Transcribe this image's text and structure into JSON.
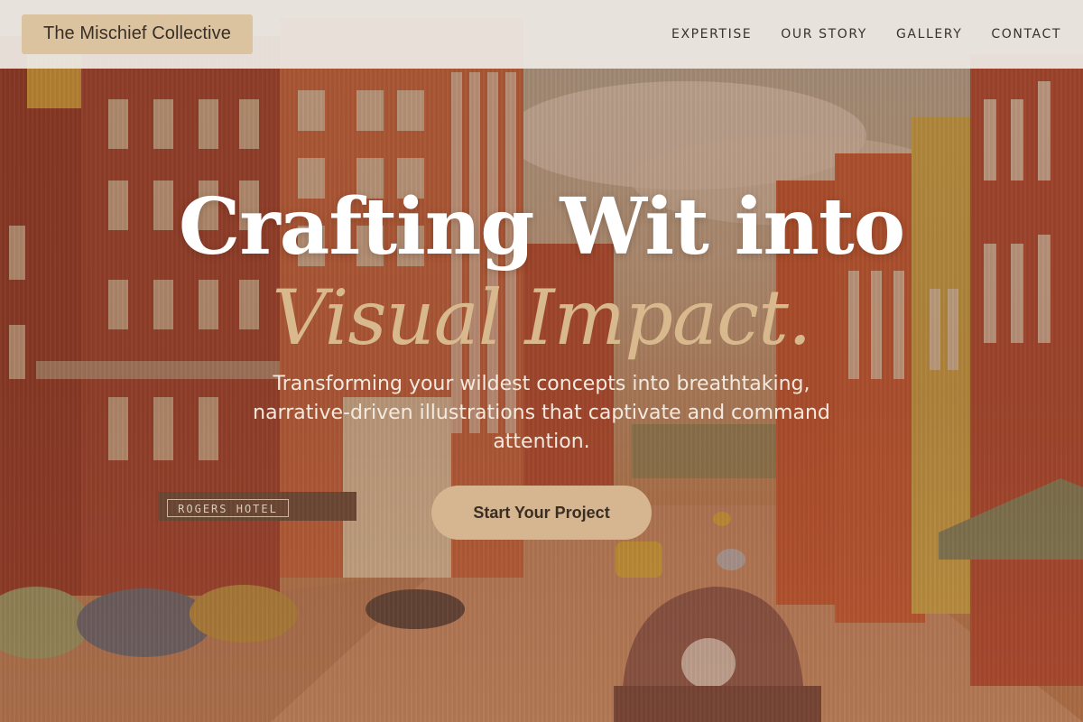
{
  "header": {
    "logo": "The Mischief Collective",
    "nav": [
      {
        "label": "EXPERTISE"
      },
      {
        "label": "OUR STORY"
      },
      {
        "label": "GALLERY"
      },
      {
        "label": "CONTACT"
      }
    ]
  },
  "hero": {
    "title_line1": "Crafting Wit into",
    "title_line2": "Visual Impact.",
    "subtitle": "Transforming your wildest concepts into breathtaking, narrative-driven illustrations that captivate and command attention.",
    "cta_label": "Start Your Project"
  },
  "background": {
    "sign_text": "ROGERS HOTEL"
  },
  "colors": {
    "header_bg": "#ece8e2",
    "logo_bg": "#dcc3a0",
    "accent": "#d8b98e",
    "cta_bg": "#d5b690",
    "title": "#ffffff"
  }
}
